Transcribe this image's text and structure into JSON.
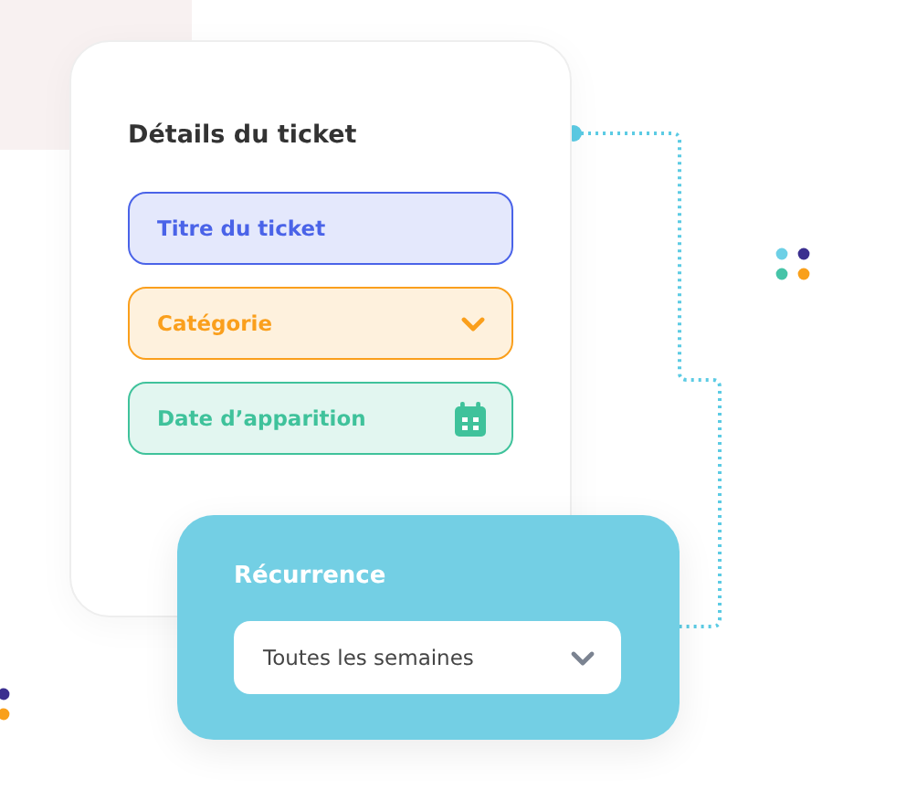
{
  "ticket_card": {
    "title": "Détails du ticket",
    "fields": [
      {
        "kind": "text",
        "label": "Titre du ticket",
        "color": "#4a63e8"
      },
      {
        "kind": "dropdown",
        "label": "Catégorie",
        "color": "#fa9f1c"
      },
      {
        "kind": "date",
        "label": "Date d’apparition",
        "color": "#3fc29b"
      }
    ]
  },
  "recurrence_card": {
    "title": "Récurrence",
    "select": {
      "value": "Toutes les semaines"
    }
  }
}
